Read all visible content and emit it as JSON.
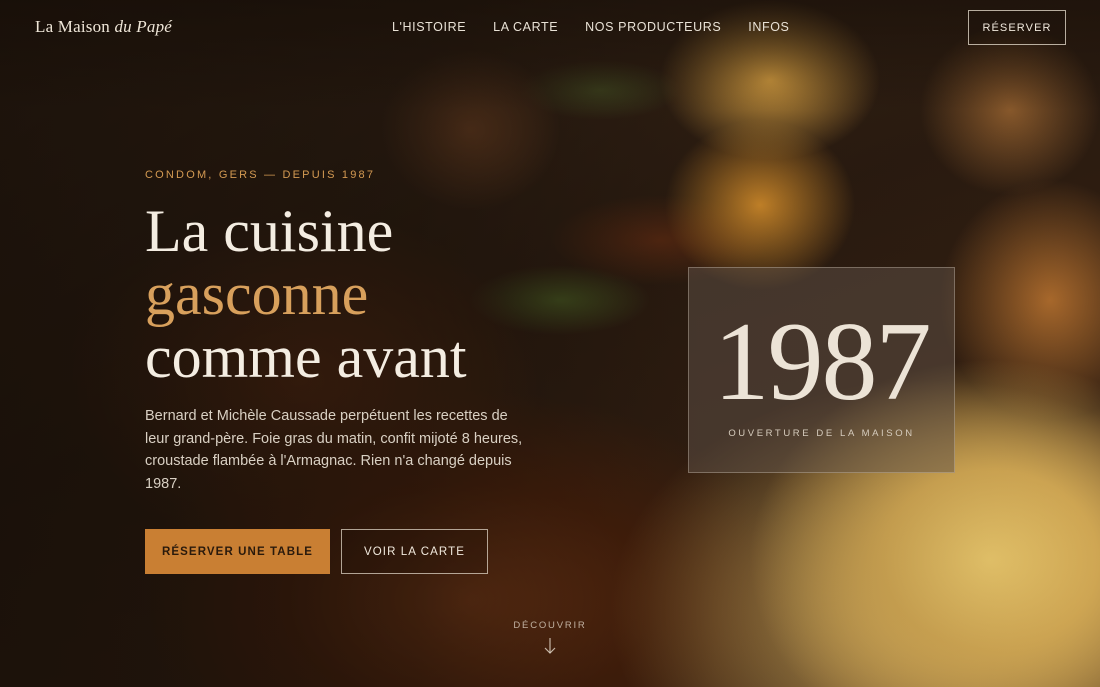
{
  "brand": {
    "name": "La Maison",
    "name_italic": "du Papé"
  },
  "nav": {
    "items": [
      {
        "label": "L'HISTOIRE"
      },
      {
        "label": "LA CARTE"
      },
      {
        "label": "NOS PRODUCTEURS"
      },
      {
        "label": "INFOS"
      }
    ],
    "cta_label": "RÉSERVER"
  },
  "hero": {
    "eyebrow": "CONDOM, GERS — DEPUIS 1987",
    "headline": {
      "line1": "La cuisine",
      "line2_accent": "gasconne",
      "line3": "comme avant"
    },
    "lede": "Bernard et Michèle Caussade perpétuent les recettes de leur grand-père. Foie gras du matin, confit mijoté 8 heures, croustade flambée à l'Armagnac. Rien n'a changé depuis 1987.",
    "primary_cta": "RÉSERVER UNE TABLE",
    "secondary_cta": "VOIR LA CARTE"
  },
  "year_card": {
    "year": "1987",
    "caption": "OUVERTURE DE LA MAISON"
  },
  "discover": {
    "label": "DÉCOUVRIR",
    "icon": "arrow-down-icon"
  },
  "colors": {
    "accent": "#d8a05c",
    "primary_button": "#c97f33",
    "text_light": "#f4ede2"
  }
}
